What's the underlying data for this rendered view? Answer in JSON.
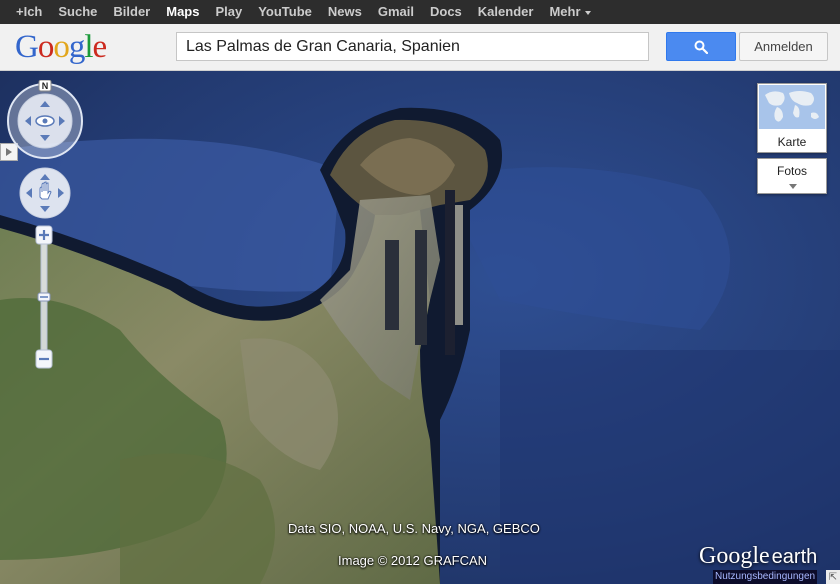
{
  "topbar": {
    "items": [
      {
        "label": "+Ich"
      },
      {
        "label": "Suche"
      },
      {
        "label": "Bilder"
      },
      {
        "label": "Maps",
        "active": true
      },
      {
        "label": "Play"
      },
      {
        "label": "YouTube"
      },
      {
        "label": "News"
      },
      {
        "label": "Gmail"
      },
      {
        "label": "Docs"
      },
      {
        "label": "Kalender"
      },
      {
        "label": "Mehr"
      }
    ]
  },
  "header": {
    "logo": "Google",
    "search_value": "Las Palmas de Gran Canaria, Spanien",
    "search_icon": "search-icon",
    "signin_label": "Anmelden"
  },
  "map": {
    "compass_label": "N",
    "layers": {
      "karte_label": "Karte",
      "fotos_label": "Fotos"
    },
    "credits": {
      "data": "Data SIO, NOAA, U.S. Navy, NGA, GEBCO",
      "image": "Image © 2012 GRAFCAN"
    },
    "earth_logo_google": "Google",
    "earth_logo_earth": "earth",
    "terms_label": "Nutzungsbedingungen"
  },
  "colors": {
    "ocean": "#2a4a8a",
    "land": "#7a8a5a",
    "topbar": "#2d2d2d",
    "search_button": "#4b8af0"
  }
}
